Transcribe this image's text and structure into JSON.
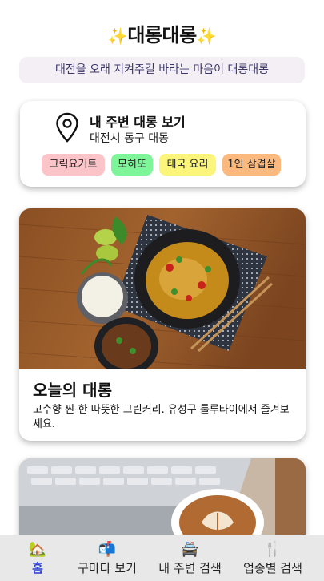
{
  "header": {
    "sparkle_left": "✨",
    "title": "대롱대롱",
    "sparkle_right": "✨"
  },
  "tagline": "대전을 오래 지켜주길 바라는 마음이 대롱대롱",
  "location_card": {
    "title": "내 주변 대롱 보기",
    "subtitle": "대전시 동구 대동",
    "chips": [
      {
        "label": "그릭요거트",
        "color": "#fbc4c9"
      },
      {
        "label": "모히또",
        "color": "#7ff59a"
      },
      {
        "label": "태국 요리",
        "color": "#fbf57c"
      },
      {
        "label": "1인 삼겹살",
        "color": "#fbb97e"
      }
    ]
  },
  "featured_card": {
    "title": "오늘의 대롱",
    "description": "고수향 찐-한 따뜻한 그린커리. 유성구 룰루타이에서 즐겨보세요."
  },
  "bottom_nav": {
    "items": [
      {
        "icon": "🏡",
        "label": "홈",
        "active": true
      },
      {
        "icon": "📬",
        "label": "구마다 보기",
        "active": false
      },
      {
        "icon": "🚔",
        "label": "내 주변 검색",
        "active": false
      },
      {
        "icon": "🍴",
        "label": "업종별 검색",
        "active": false
      }
    ]
  },
  "colors": {
    "active_tab": "#2a3bd3",
    "tagline_bg": "#f4eef5",
    "nav_bg": "#e8e8e8"
  }
}
